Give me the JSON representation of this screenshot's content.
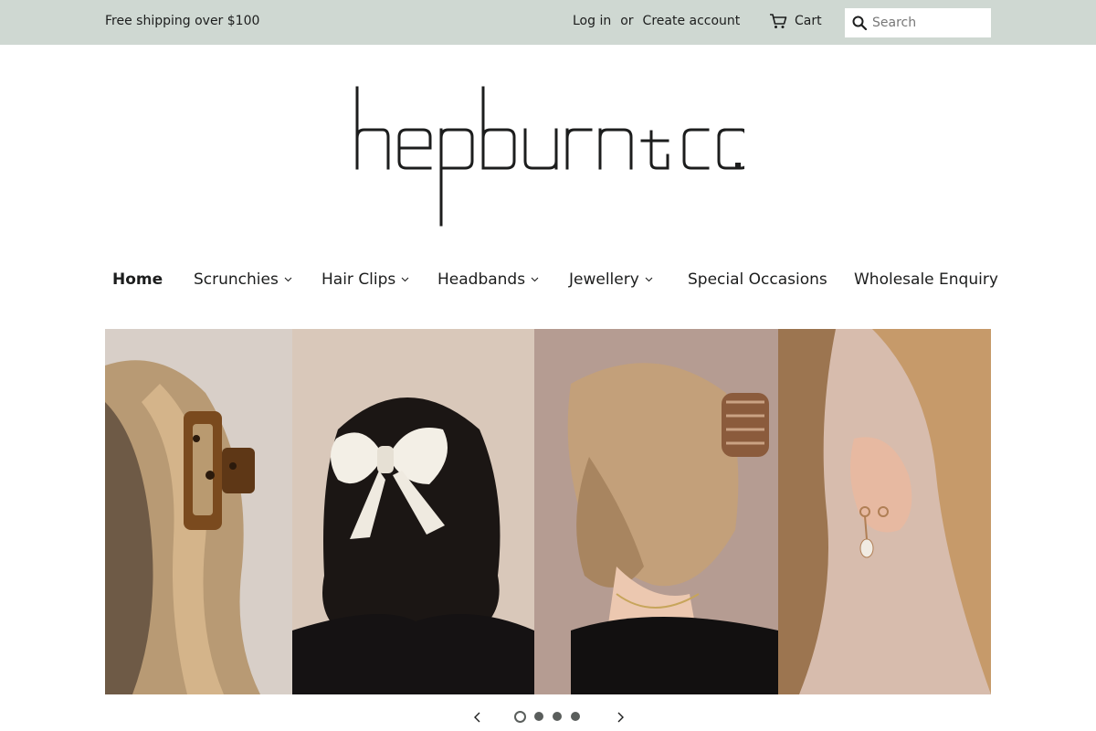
{
  "announcement": {
    "text": "Free shipping over $100"
  },
  "account": {
    "login": "Log in",
    "or": "or",
    "create": "Create account"
  },
  "cart": {
    "label": "Cart",
    "icon": "cart-icon"
  },
  "search": {
    "placeholder": "Search",
    "icon": "search-icon"
  },
  "logo": {
    "text": "hepburn & co."
  },
  "nav": {
    "items": [
      {
        "label": "Home",
        "active": true,
        "dropdown": false
      },
      {
        "label": "Scrunchies",
        "dropdown": true
      },
      {
        "label": "Hair Clips",
        "dropdown": true
      },
      {
        "label": "Headbands",
        "dropdown": true
      },
      {
        "label": "Jewellery",
        "dropdown": true
      },
      {
        "label": "Special Occasions",
        "dropdown": false
      },
      {
        "label": "Wholesale Enquiry",
        "dropdown": false
      }
    ]
  },
  "slider": {
    "slide_count": 4,
    "current_slide": 1,
    "prev_icon": "chevron-left-icon",
    "next_icon": "chevron-right-icon"
  },
  "colors": {
    "topbar_bg": "#cfd8d2",
    "text": "#1c1d1d"
  }
}
